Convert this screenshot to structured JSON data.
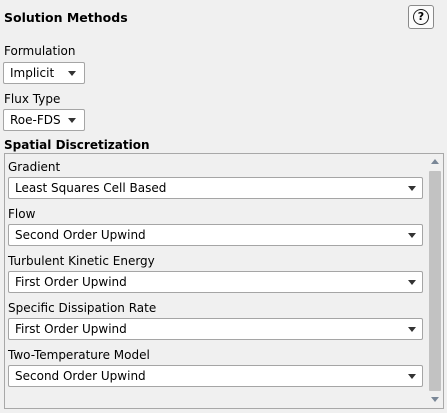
{
  "panel_title": "Solution Methods",
  "help_button": {
    "label": "?",
    "icon": "help-circle-icon"
  },
  "formulation": {
    "label": "Formulation",
    "value": "Implicit"
  },
  "flux_type": {
    "label": "Flux Type",
    "value": "Roe-FDS"
  },
  "spatial_discretization": {
    "title": "Spatial Discretization",
    "items": [
      {
        "label": "Gradient",
        "value": "Least Squares Cell Based"
      },
      {
        "label": "Flow",
        "value": "Second Order Upwind"
      },
      {
        "label": "Turbulent Kinetic Energy",
        "value": "First Order Upwind"
      },
      {
        "label": "Specific Dissipation Rate",
        "value": "First Order Upwind"
      },
      {
        "label": "Two-Temperature Model",
        "value": "Second Order Upwind"
      }
    ]
  }
}
